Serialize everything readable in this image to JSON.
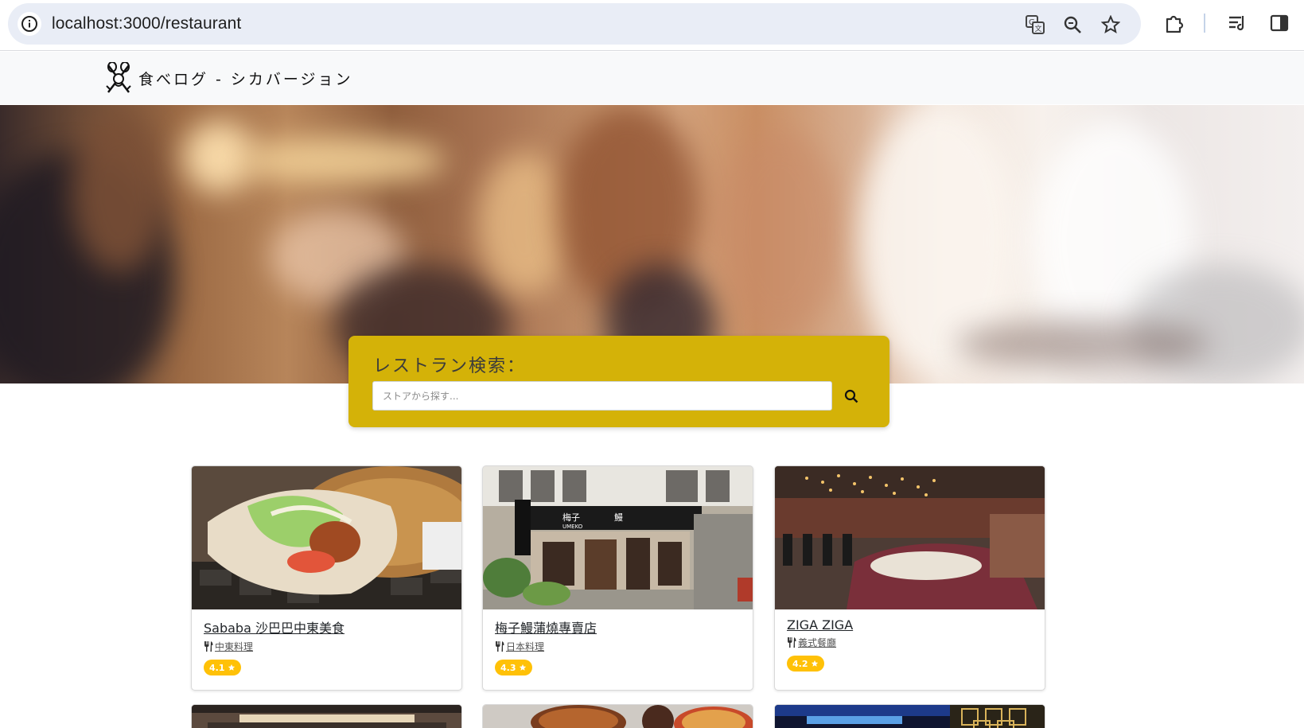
{
  "browser": {
    "url": "localhost:3000/restaurant",
    "icons": [
      "info-icon",
      "translate-icon",
      "zoom-icon",
      "bookmark-star-icon",
      "extensions-icon",
      "reading-list-icon",
      "side-panel-icon"
    ]
  },
  "navbar": {
    "brand_name": "食べログ - シカバージョン",
    "logo_icon": "fork-knife-crest-logo"
  },
  "search": {
    "title": "レストラン検索：",
    "placeholder": "ストアから探す...",
    "value": "",
    "button_icon": "search-icon"
  },
  "colors": {
    "search_panel": "#d4b208",
    "rating_badge": "#ffc107",
    "navbar_bg": "#f8f9fa"
  },
  "restaurants": [
    {
      "name": "Sababa 沙巴巴中東美食",
      "category": "中東料理",
      "rating": "4.1",
      "category_icon": "utensils-icon",
      "rating_icon": "star-icon"
    },
    {
      "name": "梅子鰻蒲燒專賣店",
      "category": "日本料理",
      "rating": "4.3",
      "category_icon": "utensils-icon",
      "rating_icon": "star-icon"
    },
    {
      "name": "ZIGA ZIGA",
      "category": "義式餐廳",
      "rating": "4.2",
      "category_icon": "utensils-icon",
      "rating_icon": "star-icon"
    }
  ]
}
